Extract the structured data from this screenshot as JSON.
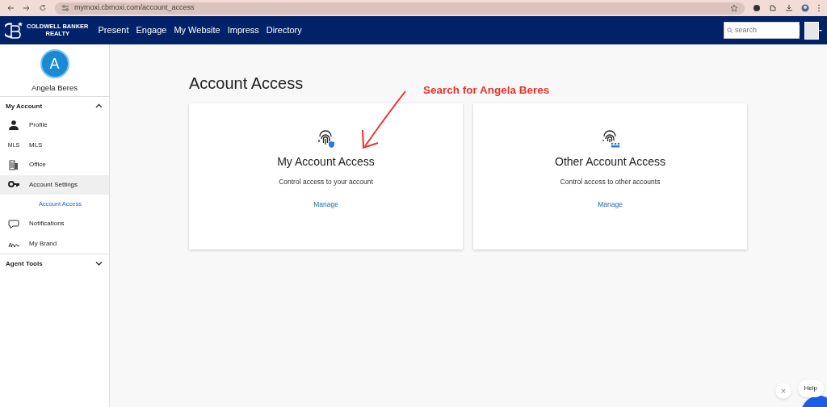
{
  "browser": {
    "url": "mymoxi.cbmoxi.com/account_access"
  },
  "navbar": {
    "logo_lines": [
      "COLDWELL BANKER",
      "REALTY"
    ],
    "links": [
      "Present",
      "Engage",
      "My Website",
      "Impress",
      "Directory"
    ],
    "search": {
      "placeholder": "search"
    }
  },
  "sidebar": {
    "avatar_letter": "A",
    "user_name": "Angela Beres",
    "sections": [
      {
        "label": "My Account",
        "expanded": true,
        "items": [
          {
            "kind": "person",
            "label": "Profile",
            "selected": false
          },
          {
            "kind": "text",
            "icon_text": "MLS",
            "label": "MLS",
            "selected": false
          },
          {
            "kind": "building",
            "label": "Office",
            "selected": false
          },
          {
            "kind": "key",
            "label": "Account Settings",
            "selected": true,
            "children": [
              {
                "label": "Account Access",
                "selected": true
              }
            ]
          },
          {
            "kind": "bubble",
            "label": "Notifications",
            "selected": false
          },
          {
            "kind": "signature",
            "label": "My Brand",
            "selected": false
          }
        ]
      },
      {
        "label": "Agent Tools",
        "expanded": false
      }
    ]
  },
  "page": {
    "title": "Account Access",
    "annotation": "Search for Angela Beres",
    "cards": [
      {
        "kind": "shield",
        "title": "My Account Access",
        "description": "Control access to your account",
        "link": "Manage"
      },
      {
        "kind": "people",
        "title": "Other Account Access",
        "description": "Control access to other accounts",
        "link": "Manage"
      }
    ]
  },
  "help": {
    "label": "Help",
    "close": "×"
  }
}
